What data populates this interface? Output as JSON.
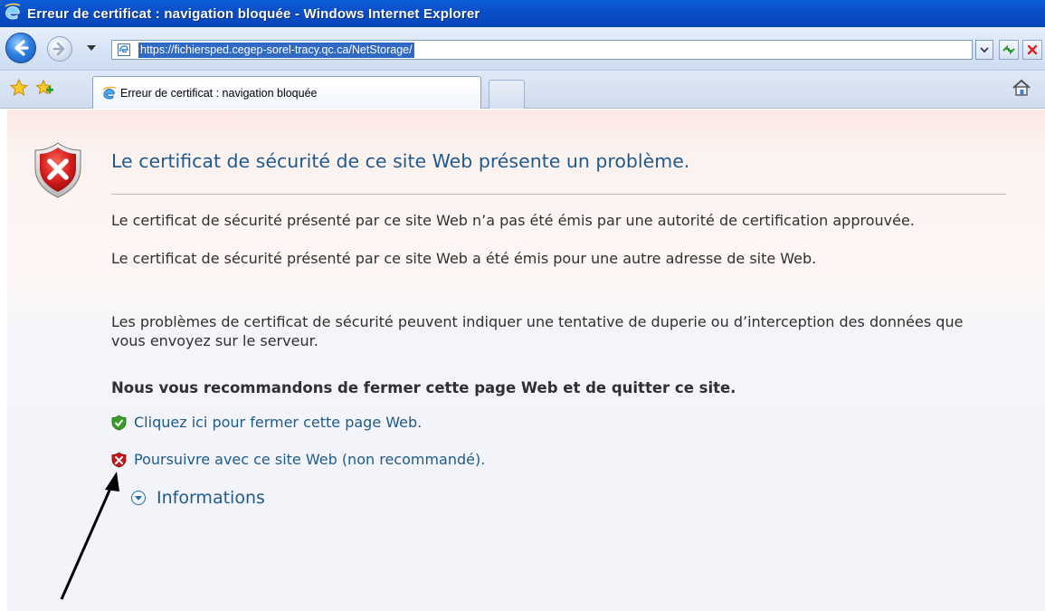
{
  "window": {
    "title": "Erreur de certificat : navigation bloquée - Windows Internet Explorer"
  },
  "navbar": {
    "url": "https://fichiersped.cegep-sorel-tracy.qc.ca/NetStorage/",
    "icons": {
      "back": "back-arrow-icon",
      "forward": "forward-arrow-icon",
      "recent": "chevron-down-icon",
      "page": "ie-page-icon",
      "refresh": "refresh-icon",
      "stop": "stop-x-icon"
    }
  },
  "tabs": {
    "active_label": "Erreur de certificat : navigation bloquée",
    "icons": {
      "favorites": "star-icon",
      "add_favorite": "add-favorite-icon",
      "home": "home-icon"
    }
  },
  "content": {
    "heading": "Le certificat de sécurité de ce site Web présente un problème.",
    "paragraph1": "Le certificat de sécurité présenté par ce site Web n’a pas été émis par une autorité de certification approuvée.",
    "paragraph2": "Le certificat de sécurité présenté par ce site Web a été émis pour une autre adresse de site Web.",
    "paragraph3": "Les problèmes de certificat de sécurité peuvent indiquer une tentative de duperie ou d’interception des données que vous envoyez sur le serveur.",
    "recommendation": "Nous vous recommandons de fermer cette page Web et de quitter ce site.",
    "link_close": "Cliquez ici pour fermer cette page Web.",
    "link_continue": "Poursuivre avec ce site Web (non recommandé).",
    "more_info": "Informations"
  },
  "colors": {
    "title_bar": "#0a4fc9",
    "heading": "#1f5a8c",
    "link": "#1f5a8c",
    "text": "#303030",
    "shield_red": "#c8161d",
    "shield_green": "#3a9a2a",
    "url_highlight": "#316ac5"
  }
}
